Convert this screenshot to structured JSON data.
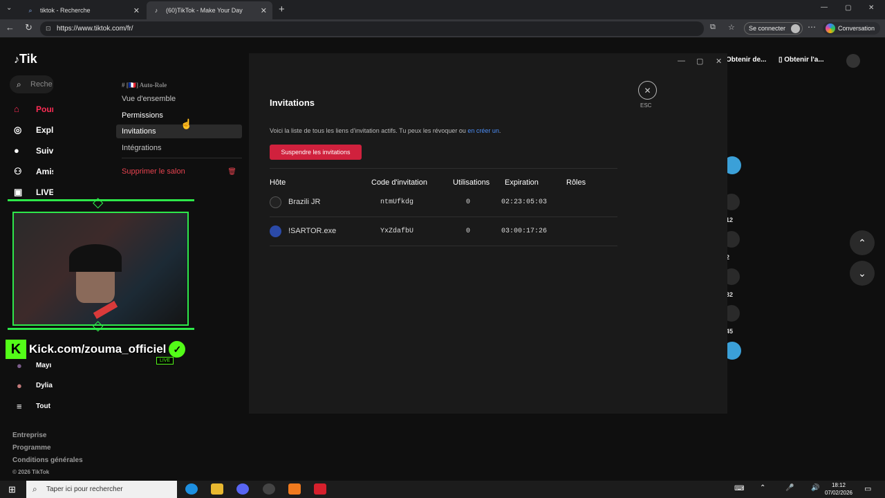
{
  "browser": {
    "tabs": [
      {
        "label": "tiktok - Recherche",
        "active": false
      },
      {
        "label": "(60)TikTok - Make Your Day",
        "active": true
      }
    ],
    "url": "https://www.tiktok.com/fr/",
    "signin_label": "Se connecter",
    "conversation_label": "Conversation"
  },
  "tiktok": {
    "logo": "Tik",
    "search_placeholder": "Reche",
    "nav": [
      "Pour",
      "Expl",
      "Suiv",
      "Amis",
      "LIVE"
    ],
    "following": [
      "Mayı",
      "Dylia"
    ],
    "see_all": "Tout",
    "footer": [
      "Entreprise",
      "Programme",
      "Conditions générales",
      "© 2026 TikTok"
    ],
    "obtain_1": "Obtenir de...",
    "obtain_2": "Obtenir l'a...",
    "right_counts": [
      "12",
      "2",
      "32",
      "45"
    ]
  },
  "overlay": {
    "kick_text": "Kick.com/zouma_officiel",
    "live_badge": "LIVE"
  },
  "discord": {
    "sidebar": {
      "channel": "[🇫🇷] Auto-Role",
      "items": [
        "Vue d'ensemble",
        "Permissions",
        "Invitations",
        "Intégrations"
      ],
      "delete": "Supprimer le salon"
    },
    "title": "Invitations",
    "desc_prefix": "Voici la liste de tous les liens d'invitation actifs. Tu peux les révoquer ou ",
    "desc_link": "en créer un",
    "desc_suffix": ".",
    "suspend_button": "Suspendre les invitations",
    "esc_label": "ESC",
    "columns": [
      "Hôte",
      "Code d'invitation",
      "Utilisations",
      "Expiration",
      "Rôles"
    ],
    "rows": [
      {
        "host": "Brazili JR",
        "code": "ntmUfkdg",
        "uses": "0",
        "expiration": "02:23:05:03"
      },
      {
        "host": "!SARTOR.exe",
        "code": "YxZdafbU",
        "uses": "0",
        "expiration": "03:00:17:26"
      }
    ]
  },
  "taskbar": {
    "search_placeholder": "Taper ici pour rechercher",
    "time": "18:12",
    "date": "07/02/2026"
  }
}
